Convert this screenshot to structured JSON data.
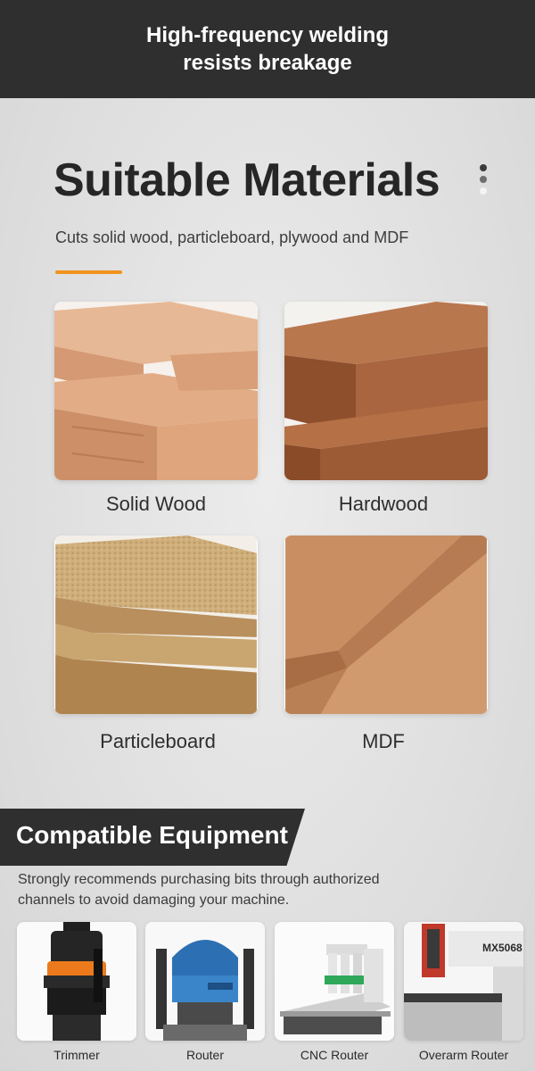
{
  "banner": {
    "line1": "High-frequency welding",
    "line2": "resists breakage"
  },
  "materials": {
    "title": "Suitable Materials",
    "subtitle": "Cuts solid wood, particleboard, plywood and MDF",
    "accent_color": "#f0931e",
    "items": [
      {
        "label": "Solid Wood",
        "image": "stacked light wood blocks"
      },
      {
        "label": "Hardwood",
        "image": "dark hardwood planks"
      },
      {
        "label": "Particleboard",
        "image": "particleboard sheets"
      },
      {
        "label": "MDF",
        "image": "MDF boards"
      }
    ]
  },
  "equipment": {
    "title": "Compatible Equipment",
    "description": "Strongly recommends purchasing bits through authorized channels to avoid damaging your machine.",
    "items": [
      {
        "label": "Trimmer",
        "image": "black and orange trimmer"
      },
      {
        "label": "Router",
        "image": "blue plunge router"
      },
      {
        "label": "CNC Router",
        "image": "CNC router machine"
      },
      {
        "label": "Overarm Router",
        "image": "overarm router machine",
        "machine_text": "MX5068"
      }
    ]
  }
}
